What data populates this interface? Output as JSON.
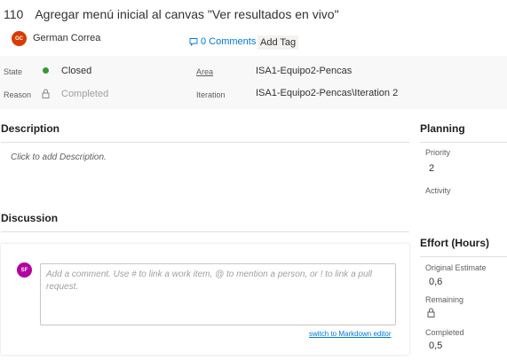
{
  "work_item": {
    "id": "110",
    "title": "Agregar menú inicial al canvas \"Ver resultados en vivo\"",
    "author_initials": "GC",
    "author_name": "German Correa",
    "comments_link": "0 Comments",
    "add_tag": "Add Tag"
  },
  "fields": {
    "state_label": "State",
    "state_value": "Closed",
    "reason_label": "Reason",
    "reason_value": "Completed",
    "area_label": "Area",
    "area_value": "ISA1-Equipo2-Pencas",
    "iteration_label": "Iteration",
    "iteration_value": "ISA1-Equipo2-Pencas\\Iteration 2"
  },
  "description": {
    "heading": "Description",
    "placeholder": "Click to add Description."
  },
  "discussion": {
    "heading": "Discussion",
    "user_initials": "SF",
    "comment_placeholder": "Add a comment. Use # to link a work item, @ to mention a person, or ! to link a pull request.",
    "markdown_link": "switch to Markdown editor"
  },
  "planning": {
    "heading": "Planning",
    "priority_label": "Priority",
    "priority_value": "2",
    "activity_label": "Activity",
    "activity_value": ""
  },
  "effort": {
    "heading": "Effort (Hours)",
    "original_estimate_label": "Original Estimate",
    "original_estimate_value": "0,6",
    "remaining_label": "Remaining",
    "completed_label": "Completed",
    "completed_value": "0,5"
  },
  "colors": {
    "state_closed": "#339933",
    "link": "#0078d4",
    "author_avatar": "#d83b01",
    "user_avatar": "#b4009e"
  },
  "icons": [
    "comment-icon",
    "lock-icon"
  ]
}
